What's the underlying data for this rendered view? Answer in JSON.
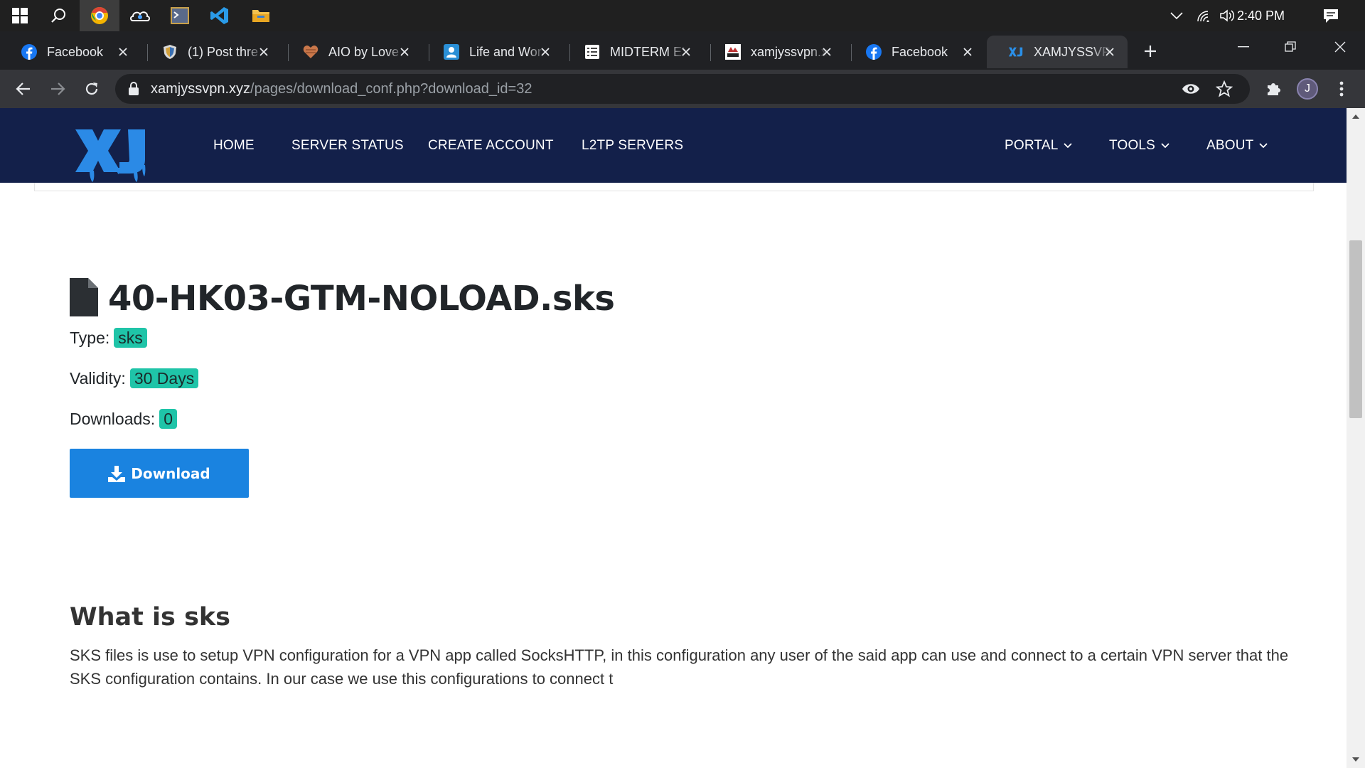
{
  "taskbar": {
    "icons": [
      "windows-start-icon",
      "search-icon",
      "chrome-icon",
      "onedrive-icon",
      "terminal-icon",
      "vscode-icon",
      "file-explorer-icon"
    ],
    "clock": "2:40 PM"
  },
  "tabs": [
    {
      "title": "Facebook",
      "icon": "facebook-icon"
    },
    {
      "title": "(1) Post thre",
      "icon": "shield-icon"
    },
    {
      "title": "AIO by Love",
      "icon": "heart-icon"
    },
    {
      "title": "Life and Wor",
      "icon": "contact-icon"
    },
    {
      "title": "MIDTERM EX",
      "icon": "list-icon"
    },
    {
      "title": "xamjyssvpn.x",
      "icon": "site-icon"
    },
    {
      "title": "Facebook",
      "icon": "facebook-icon"
    },
    {
      "title": "XAMJYSSVPN",
      "icon": "xj-icon",
      "active": true
    }
  ],
  "address": {
    "host": "xamjyssvpn.xyz",
    "path": "/pages/download_conf.php?download_id=32"
  },
  "profile_initial": "J",
  "site": {
    "logo_text": "XJ",
    "nav_left": [
      "HOME",
      "SERVER STATUS",
      "CREATE ACCOUNT",
      "L2TP SERVERS"
    ],
    "nav_right": [
      "PORTAL",
      "TOOLS",
      "ABOUT"
    ]
  },
  "file": {
    "name": "40-HK03-GTM-NOLOAD.sks",
    "type_label": "Type:",
    "type_value": "sks",
    "validity_label": "Validity:",
    "validity_value": "30 Days",
    "downloads_label": "Downloads:",
    "downloads_value": "0",
    "download_button": "Download"
  },
  "about": {
    "heading": "What is sks",
    "body": "SKS files is use to setup VPN configuration for a VPN app called SocksHTTP, in this configuration any user of the said app can use and connect to a certain VPN server that the SKS configuration contains. In our case we use this configurations to connect t"
  },
  "colors": {
    "navbar": "#13204a",
    "badge": "#1fc4a8",
    "button": "#1a83e0"
  }
}
